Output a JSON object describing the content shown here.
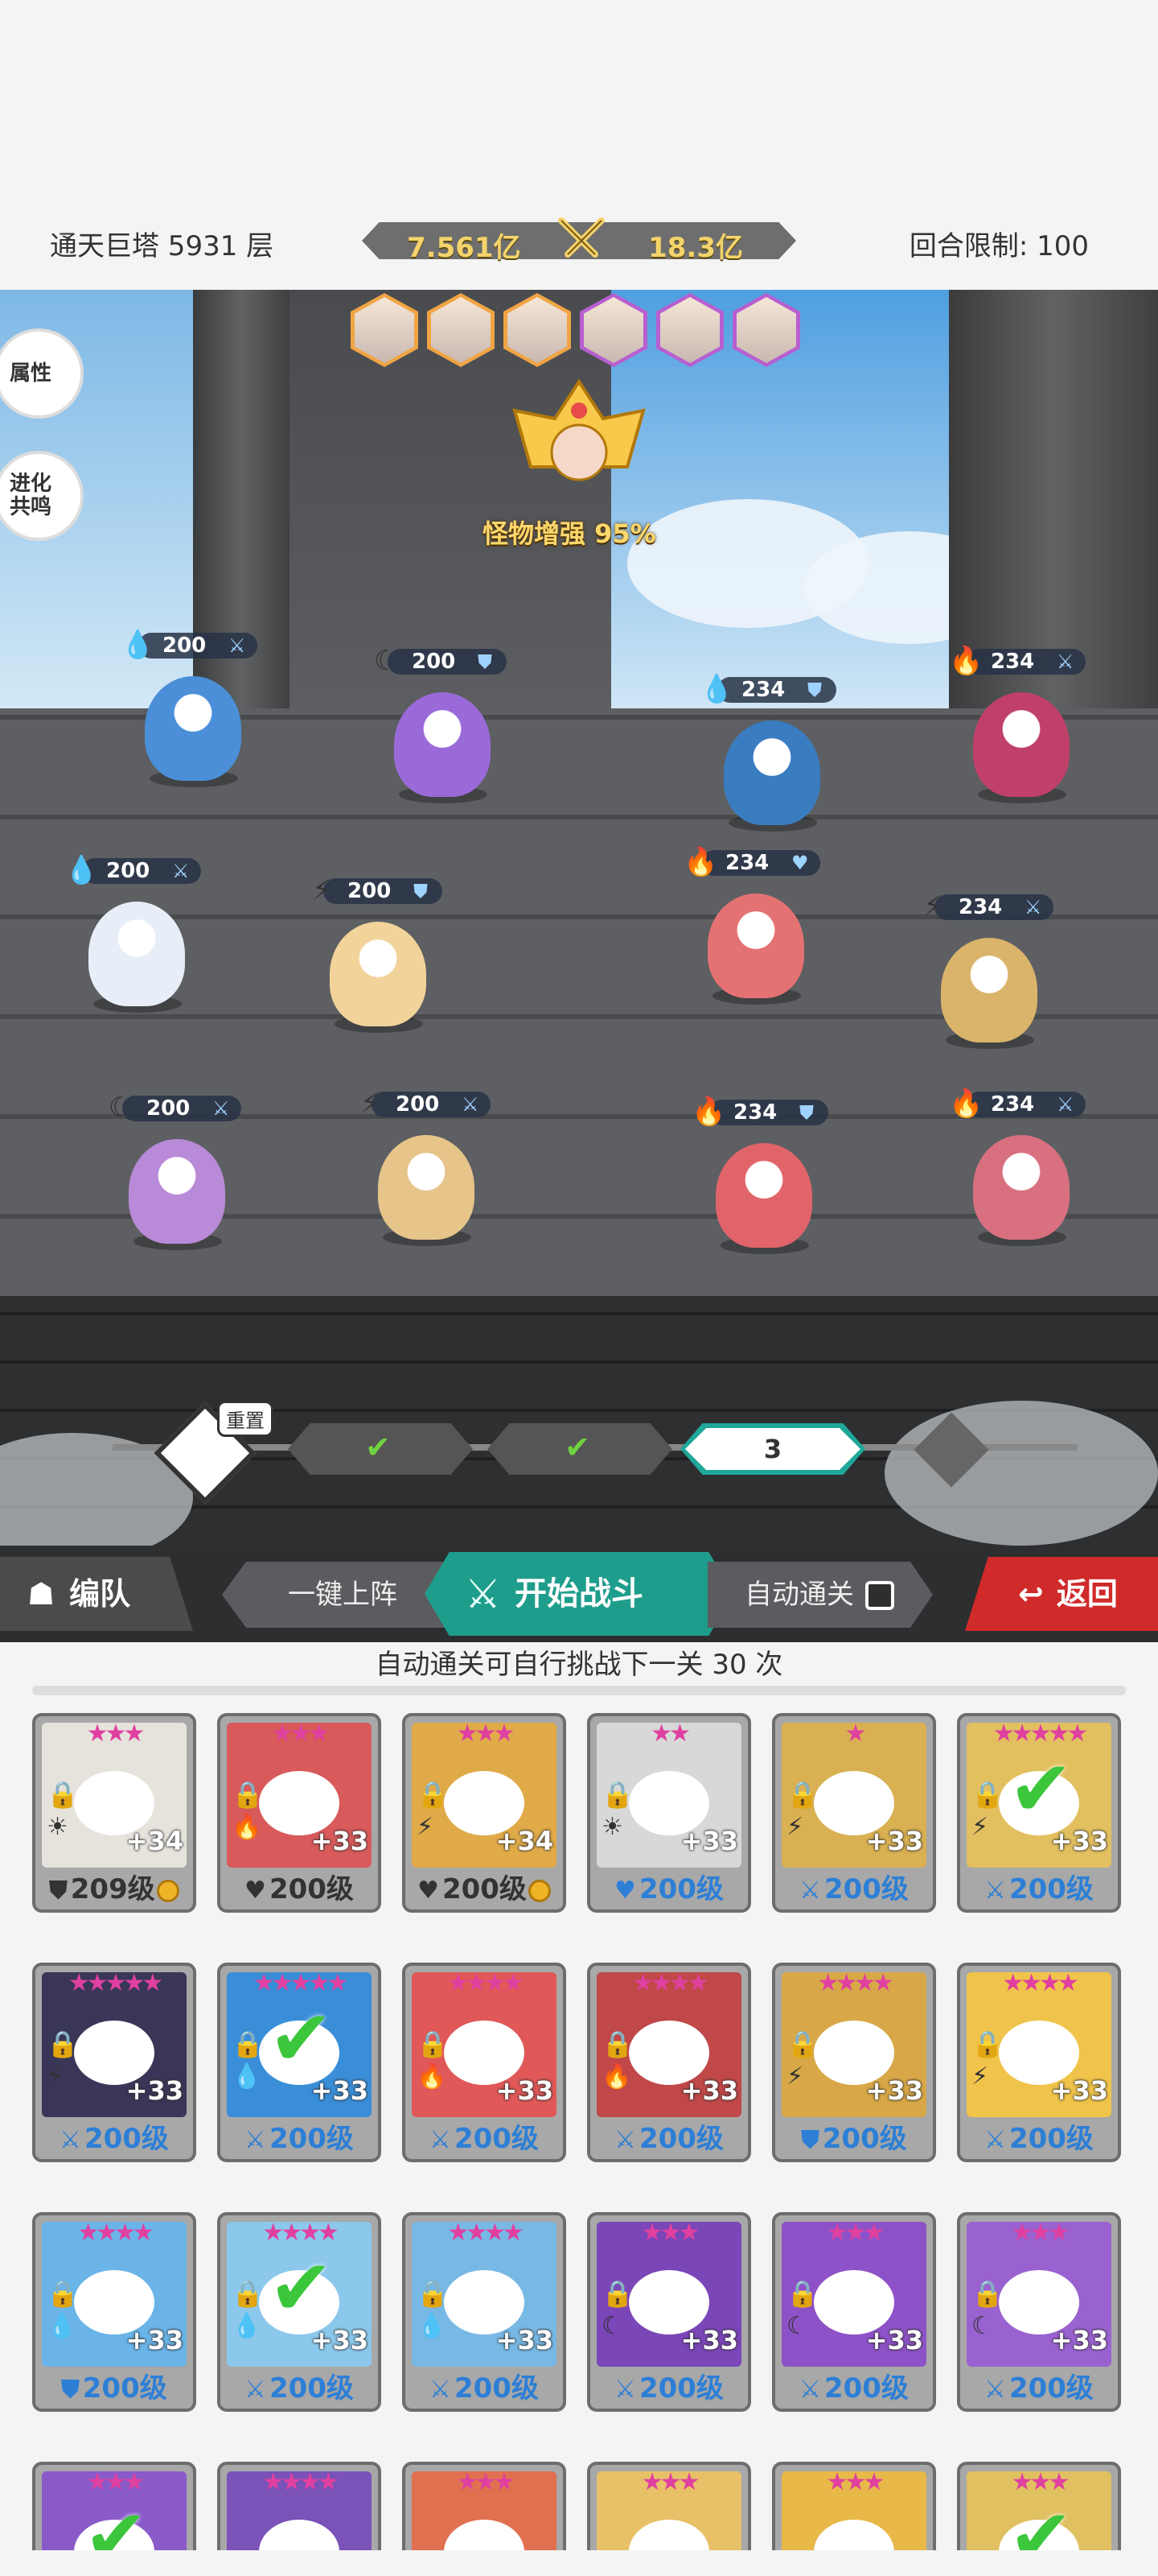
{
  "top": {
    "tower": "通天巨塔 5931 层",
    "power_left": "7.561亿",
    "power_right": "18.3亿",
    "round_limit": "回合限制: 100"
  },
  "side_buttons": {
    "attributes": "属性",
    "evolve_line1": "进化",
    "evolve_line2": "共鸣"
  },
  "boss": {
    "buff_text": "怪物增强 95%"
  },
  "enemy_avatars": [
    {
      "color": "#f0a444"
    },
    {
      "color": "#f0a444"
    },
    {
      "color": "#f0a444"
    },
    {
      "color": "#b75fd0"
    },
    {
      "color": "#b75fd0"
    },
    {
      "color": "#b75fd0"
    }
  ],
  "units": [
    {
      "elem": "💧",
      "lvl": "200",
      "role": "⚔",
      "color": "#4a8fd8"
    },
    {
      "elem": "☾",
      "lvl": "200",
      "role": "⛊",
      "color": "#9a6ad8"
    },
    {
      "elem": "💧",
      "lvl": "234",
      "role": "⛊",
      "color": "#3a7cc0"
    },
    {
      "elem": "🔥",
      "lvl": "234",
      "role": "⚔",
      "color": "#c0406a"
    },
    {
      "elem": "💧",
      "lvl": "200",
      "role": "⚔",
      "color": "#e8eef8"
    },
    {
      "elem": "⚡",
      "lvl": "200",
      "role": "⛊",
      "color": "#f2d39a"
    },
    {
      "elem": "🔥",
      "lvl": "234",
      "role": "♥",
      "color": "#e47272"
    },
    {
      "elem": "⚡",
      "lvl": "234",
      "role": "⚔",
      "color": "#d9b46a"
    },
    {
      "elem": "☾",
      "lvl": "200",
      "role": "⚔",
      "color": "#b98ad8"
    },
    {
      "elem": "⚡",
      "lvl": "200",
      "role": "⚔",
      "color": "#e6c48a"
    },
    {
      "elem": "🔥",
      "lvl": "234",
      "role": "⛊",
      "color": "#e0646a"
    },
    {
      "elem": "🔥",
      "lvl": "234",
      "role": "⚔",
      "color": "#d87080"
    }
  ],
  "stages": {
    "reset": "重置",
    "current": "3"
  },
  "actions": {
    "team": "编队",
    "auto_deploy": "一键上阵",
    "start": "开始战斗",
    "auto_clear": "自动通关",
    "back": "返回"
  },
  "auto_info": "自动通关可自行挑战下一关 30 次",
  "heroes": [
    {
      "stars": "★★★",
      "plus": "+34",
      "level": "209级",
      "art": "#e6e2dc",
      "elem": "☀",
      "role": "⛊",
      "coin": true,
      "checked": false,
      "lvlcolor": "#333"
    },
    {
      "stars": "★★★",
      "plus": "+33",
      "level": "200级",
      "art": "#d85a5a",
      "elem": "🔥",
      "role": "♥",
      "coin": false,
      "checked": false,
      "lvlcolor": "#333"
    },
    {
      "stars": "★★★",
      "plus": "+34",
      "level": "200级",
      "art": "#e0aa48",
      "elem": "⚡",
      "role": "♥",
      "coin": true,
      "checked": false,
      "lvlcolor": "#333"
    },
    {
      "stars": "★★",
      "plus": "+33",
      "level": "200级",
      "art": "#d8d8d8",
      "elem": "☀",
      "role": "♥",
      "coin": false,
      "checked": false,
      "lvlcolor": "#2d7fd6"
    },
    {
      "stars": "★",
      "plus": "+33",
      "level": "200级",
      "art": "#d9b052",
      "elem": "⚡",
      "role": "⚔",
      "coin": false,
      "checked": false,
      "lvlcolor": "#2d7fd6"
    },
    {
      "stars": "★★★★★",
      "plus": "+33",
      "level": "200级",
      "art": "#e2c060",
      "elem": "⚡",
      "role": "⚔",
      "coin": false,
      "checked": true,
      "lvlcolor": "#2d7fd6"
    },
    {
      "stars": "★★★★★",
      "plus": "+33",
      "level": "200级",
      "art": "#3a3658",
      "elem": "⚡",
      "role": "⚔",
      "coin": false,
      "checked": false,
      "lvlcolor": "#2d7fd6"
    },
    {
      "stars": "★★★★★",
      "plus": "+33",
      "level": "200级",
      "art": "#3a8ed8",
      "elem": "💧",
      "role": "⚔",
      "coin": false,
      "checked": true,
      "lvlcolor": "#2d7fd6"
    },
    {
      "stars": "★★★★",
      "plus": "+33",
      "level": "200级",
      "art": "#e05858",
      "elem": "🔥",
      "role": "⚔",
      "coin": false,
      "checked": false,
      "lvlcolor": "#2d7fd6"
    },
    {
      "stars": "★★★★",
      "plus": "+33",
      "level": "200级",
      "art": "#c04848",
      "elem": "🔥",
      "role": "⚔",
      "coin": false,
      "checked": false,
      "lvlcolor": "#2d7fd6"
    },
    {
      "stars": "★★★★",
      "plus": "+33",
      "level": "200级",
      "art": "#d8a848",
      "elem": "⚡",
      "role": "⛊",
      "coin": false,
      "checked": false,
      "lvlcolor": "#2d7fd6"
    },
    {
      "stars": "★★★★",
      "plus": "+33",
      "level": "200级",
      "art": "#f0c44a",
      "elem": "⚡",
      "role": "⚔",
      "coin": false,
      "checked": false,
      "lvlcolor": "#2d7fd6"
    },
    {
      "stars": "★★★★",
      "plus": "+33",
      "level": "200级",
      "art": "#6ab4e8",
      "elem": "💧",
      "role": "⛊",
      "coin": false,
      "checked": false,
      "lvlcolor": "#2d7fd6"
    },
    {
      "stars": "★★★★",
      "plus": "+33",
      "level": "200级",
      "art": "#8cc8ec",
      "elem": "💧",
      "role": "⚔",
      "coin": false,
      "checked": true,
      "lvlcolor": "#2d7fd6"
    },
    {
      "stars": "★★★★",
      "plus": "+33",
      "level": "200级",
      "art": "#78b8e4",
      "elem": "💧",
      "role": "⚔",
      "coin": false,
      "checked": false,
      "lvlcolor": "#2d7fd6"
    },
    {
      "stars": "★★★",
      "plus": "+33",
      "level": "200级",
      "art": "#7a46b8",
      "elem": "☾",
      "role": "⚔",
      "coin": false,
      "checked": false,
      "lvlcolor": "#2d7fd6"
    },
    {
      "stars": "★★★",
      "plus": "+33",
      "level": "200级",
      "art": "#8e52c8",
      "elem": "☾",
      "role": "⚔",
      "coin": false,
      "checked": false,
      "lvlcolor": "#2d7fd6"
    },
    {
      "stars": "★★★",
      "plus": "+33",
      "level": "200级",
      "art": "#9a62d0",
      "elem": "☾",
      "role": "⚔",
      "coin": false,
      "checked": false,
      "lvlcolor": "#2d7fd6"
    },
    {
      "stars": "★★★",
      "plus": "",
      "level": "",
      "art": "#8a5ac8",
      "elem": "",
      "role": "",
      "coin": false,
      "checked": true,
      "lvlcolor": "#2d7fd6"
    },
    {
      "stars": "★★★★",
      "plus": "",
      "level": "",
      "art": "#7a52b8",
      "elem": "",
      "role": "",
      "coin": false,
      "checked": false,
      "lvlcolor": "#2d7fd6"
    },
    {
      "stars": "★★★",
      "plus": "",
      "level": "",
      "art": "#e07050",
      "elem": "",
      "role": "",
      "coin": false,
      "checked": false,
      "lvlcolor": "#2d7fd6"
    },
    {
      "stars": "★★★",
      "plus": "",
      "level": "",
      "art": "#e8c068",
      "elem": "",
      "role": "",
      "coin": false,
      "checked": false,
      "lvlcolor": "#2d7fd6"
    },
    {
      "stars": "★★★",
      "plus": "",
      "level": "",
      "art": "#e8b848",
      "elem": "",
      "role": "",
      "coin": false,
      "checked": false,
      "lvlcolor": "#2d7fd6"
    },
    {
      "stars": "★★★",
      "plus": "",
      "level": "",
      "art": "#e0c060",
      "elem": "",
      "role": "",
      "coin": false,
      "checked": true,
      "lvlcolor": "#2d7fd6"
    }
  ]
}
